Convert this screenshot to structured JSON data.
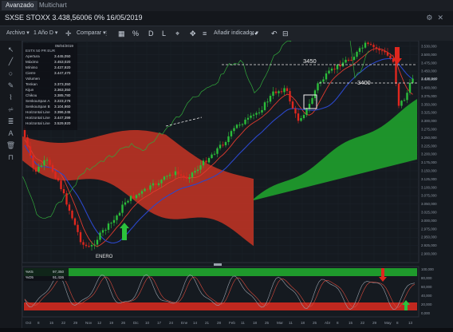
{
  "tabs": [
    {
      "label": "Avanzado",
      "active": true
    },
    {
      "label": "Multichart",
      "active": false
    }
  ],
  "window": {
    "symbol": "SXSE STOXX",
    "last": "3.438,56006",
    "change": "0%",
    "date": "16/05/2019"
  },
  "toolbar": {
    "archivo": "Archivo",
    "period": "1 Año D",
    "compare": "Comparar",
    "add_indicator": "Añadir indicador"
  },
  "tool_icons": [
    "cursor-icon",
    "line-tool-icon",
    "circle-tool-icon",
    "pencil-icon",
    "brush-icon",
    "fibonacci-icon",
    "text-tool-icon",
    "trash-icon",
    "magnet-icon"
  ],
  "info_panel": {
    "date": "05/04/2019",
    "instrument": "ESTX 50 PR EUR",
    "rows": [
      {
        "label": "Apertura",
        "value": "3.445,050"
      },
      {
        "label": "Máximo",
        "value": "3.453,020"
      },
      {
        "label": "Mínimo",
        "value": "3.437,920"
      },
      {
        "label": "Cierre",
        "value": "3.447,470"
      },
      {
        "label": "Volumen",
        "value": ""
      },
      {
        "label": "Tenkan",
        "value": "3.373,350"
      },
      {
        "label": "Kijun",
        "value": "3.363,350"
      },
      {
        "label": "Chikou",
        "value": "3.385,780"
      },
      {
        "label": "SenkouSpan A",
        "value": "3.223,278"
      },
      {
        "label": "SenkouSpan B",
        "value": "3.104,860"
      },
      {
        "label": "Horizontal Line",
        "value": "3.396,245"
      },
      {
        "label": "Horizontal Line",
        "value": "3.447,399"
      },
      {
        "label": "Horizontal Line",
        "value": "3.529,920"
      }
    ]
  },
  "annotations": {
    "level_high": "3450",
    "level_low": "3400",
    "month_label": "ENERO"
  },
  "price_axis": [
    "3.530,000",
    "3.500,000",
    "3.475,000",
    "3.450,000",
    "3.425,000",
    "3.400,000",
    "3.375,000",
    "3.350,000",
    "3.325,000",
    "3.300,000",
    "3.275,000",
    "3.250,000",
    "3.225,000",
    "3.200,000",
    "3.175,000",
    "3.150,000",
    "3.125,000",
    "3.100,000",
    "3.075,000",
    "3.050,000",
    "3.025,000",
    "3.000,000",
    "2.975,000",
    "2.950,000",
    "2.925,000",
    "2.900,000"
  ],
  "time_axis": [
    "Oct",
    "8",
    "15",
    "22",
    "29",
    "Nov",
    "12",
    "19",
    "26",
    "Dic",
    "10",
    "17",
    "24",
    "Ene",
    "14",
    "21",
    "28",
    "Feb",
    "11",
    "18",
    "25",
    "Mar",
    "11",
    "18",
    "25",
    "Abr",
    "8",
    "15",
    "22",
    "29",
    "May",
    "8",
    "13"
  ],
  "oscillator": {
    "rows": [
      {
        "label": "%K5",
        "value": "97,350"
      },
      {
        "label": "%D5",
        "value": "91,426"
      }
    ],
    "axis": [
      "100,000",
      "80,000",
      "60,000",
      "40,000",
      "20,000",
      "0,000"
    ]
  },
  "colors": {
    "bull": "#2bbd3a",
    "bear": "#e0271e",
    "cloud_bull": "#1f9a2c",
    "cloud_bear": "#b93224",
    "tenkan": "#e03a2e",
    "kijun": "#2b47c9",
    "chikou": "#31a83b",
    "background": "#151a20"
  }
}
